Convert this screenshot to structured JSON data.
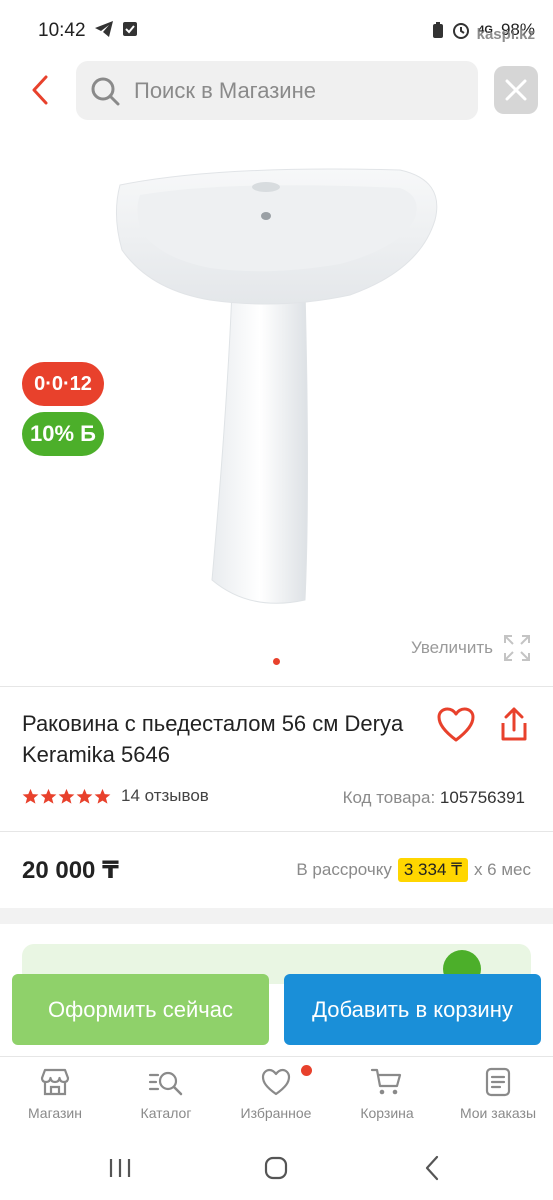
{
  "status": {
    "time": "10:42",
    "network": "4G",
    "battery": "98%",
    "watermark": "kaspi.kz"
  },
  "header": {
    "search_placeholder": "Поиск в Магазине",
    "icons": [
      "chevron-left-icon",
      "search-icon",
      "close-icon"
    ]
  },
  "product": {
    "badge_installment": "0·0·12",
    "badge_bonus": "10% Б",
    "zoom_label": "Увеличить",
    "title": "Раковина с пьедесталом 56 см Derya Keramika 5646",
    "rating": 5,
    "reviews": "14 отзывов",
    "sku_label": "Код товара:",
    "sku_value": "105756391",
    "price": "20 000 ₸",
    "installment_prefix": "В рассрочку",
    "installment_amount": "3 334 ₸",
    "installment_suffix": "х 6 мес"
  },
  "actions": {
    "checkout": "Оформить сейчас",
    "add_to_cart": "Добавить в корзину"
  },
  "nav": {
    "items": [
      {
        "label": "Магазин",
        "icon": "store-icon"
      },
      {
        "label": "Каталог",
        "icon": "catalog-icon"
      },
      {
        "label": "Избранное",
        "icon": "heart-icon"
      },
      {
        "label": "Корзина",
        "icon": "cart-icon"
      },
      {
        "label": "Мои заказы",
        "icon": "orders-icon"
      }
    ]
  },
  "colors": {
    "accent_red": "#e8412c",
    "accent_green": "#4caf2a",
    "checkout_green": "#8fd16a",
    "cart_blue": "#1a8fd8",
    "installment_yellow": "#ffd600"
  }
}
